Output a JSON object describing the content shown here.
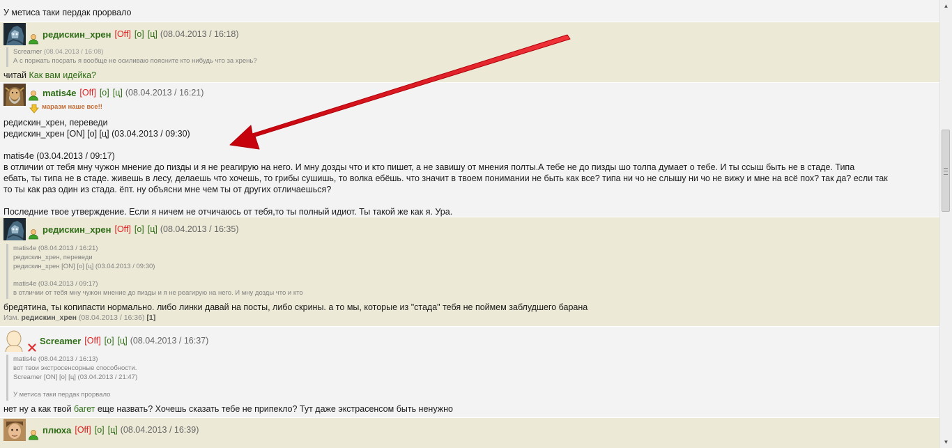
{
  "top_text": "У метиса таки пердак прорвало",
  "posts": [
    {
      "nick": "редискин_хрен",
      "off": "[Off]",
      "o": "[о]",
      "ts": "[ц]",
      "date": "(08.04.2013 / 16:18)",
      "quote": {
        "author": "Screamer",
        "date": "(08.04.2013 / 16:08)",
        "line": "А с поржать посрать я вообще не осиливаю поясните кто нибудь что за хрень?"
      },
      "body_prefix": "читай ",
      "body_link": "Как вам идейка?"
    },
    {
      "nick": "matis4e",
      "off": "[Off]",
      "o": "[о]",
      "ts": "[ц]",
      "date": "(08.04.2013 / 16:21)",
      "status": "маразм наше все!!",
      "lines": [
        "редискин_хрен, переведи",
        "редискин_хрен [ON] [о] [ц] (03.04.2013 / 09:30)",
        "",
        "matis4e (03.04.2013 / 09:17)",
        "в отличии от тебя мну чужон мнение до пизды и я не реагирую на него. И мну дозды что и кто пишет, а не завишу от мнения полты.А тебе не до пизды шо толпа думает о тебе. И ты ссыш быть не в стаде. Типа",
        "ебать, ты типа не в стаде. живешь в лесу, делаешь что хочешь, то грибы сушишь, то волка ебёшь. что значит в твоем понимании не быть как все? типа ни чо не слышу ни чо не вижу и мне на всё пох? так да? если так",
        "то ты как раз один из стада. ёпт. ну объясни мне чем ты от других отличаешься?",
        "",
        "Последние твое утверждение. Если я ничем не отчичаюсь от тебя,то ты полный идиот. Ты такой же как я. Ура."
      ]
    },
    {
      "nick": "редискин_хрен",
      "off": "[Off]",
      "o": "[о]",
      "ts": "[ц]",
      "date": "(08.04.2013 / 16:35)",
      "quote_lines": [
        "matis4e (08.04.2013 / 16:21)",
        "редискин_хрен, переведи",
        "редискин_хрен [ON] [о] [ц] (03.04.2013 / 09:30)",
        "",
        "matis4e (03.04.2013 / 09:17)",
        "в отличии от тебя мну чужон мнение до пизды и я не реагирую на него. И мну дозды что и кто"
      ],
      "body": "бредятина, ты копипасти нормально. либо линки давай на посты, либо скрины. а то мы, которые из \"стада\" тебя не поймем заблудшего барана",
      "edited_prefix": "Изм.",
      "edited_by": "редискин_хрен",
      "edited_date": "(08.04.2013 / 16:36)",
      "edited_count": "[1]"
    },
    {
      "nick": "Screamer",
      "off": "[Off]",
      "o": "[о]",
      "ts": "[ц]",
      "date": "(08.04.2013 / 16:37)",
      "quote_lines": [
        "matis4e (08.04.2013 / 16:13)",
        "вот твои экстросенсорные способности.",
        "Screamer [ON] [о] [ц] (03.04.2013 / 21:47)",
        "",
        "У метиса таки пердак прорвало"
      ],
      "body_prefix": "нет ну а как твой ",
      "body_link": "багет",
      "body_suffix": " еще назвать? Хочешь сказать тебе не припекло? Тут даже экстрасенсом быть ненужно"
    },
    {
      "nick": "плюха",
      "off": "[Off]",
      "o": "[о]",
      "ts": "[ц]",
      "date": "(08.04.2013 / 16:39)"
    }
  ],
  "colors": {
    "beige": "#ece9d6",
    "nick_green": "#2f6d17",
    "off_red": "#dd2222",
    "arrow_red": "#e8141e"
  },
  "icons": {
    "online_status": "user-green-icon",
    "offline_status": "user-offline-x-icon",
    "mood": "mood-arrow-icon"
  }
}
